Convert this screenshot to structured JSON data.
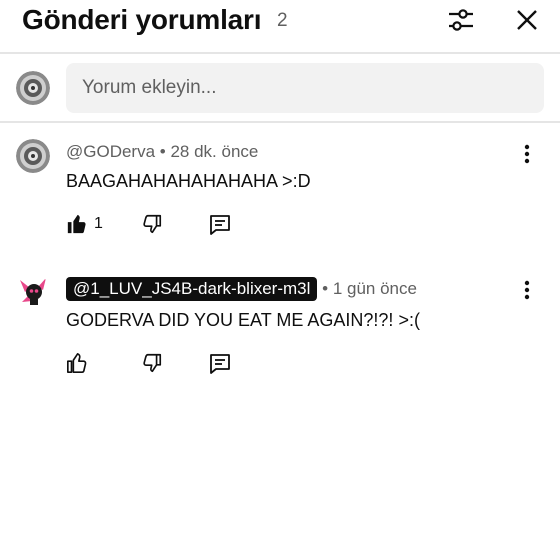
{
  "header": {
    "title": "Gönderi yorumları",
    "count": "2",
    "filter_icon": "sliders-icon",
    "close_icon": "close-icon"
  },
  "composer": {
    "placeholder": "Yorum ekleyin..."
  },
  "comments": [
    {
      "author": "@GODerva",
      "time": "• 28 dk. önce",
      "text": "BAAGAHAHAHAHAHAHA >:D",
      "likes": "1",
      "liked": true
    },
    {
      "author": "@1_LUV_JS4B-dark-blixer-m3l",
      "time": "• 1 gün önce",
      "text": "GODERVA DID YOU EAT ME AGAIN?!?! >:(",
      "likes": "",
      "liked": false
    }
  ],
  "colors": {
    "text": "#0f0f0f",
    "secondary": "#606060",
    "input_bg": "#f2f2f2",
    "divider": "#e5e5e5",
    "accent_pink": "#e8488a"
  }
}
